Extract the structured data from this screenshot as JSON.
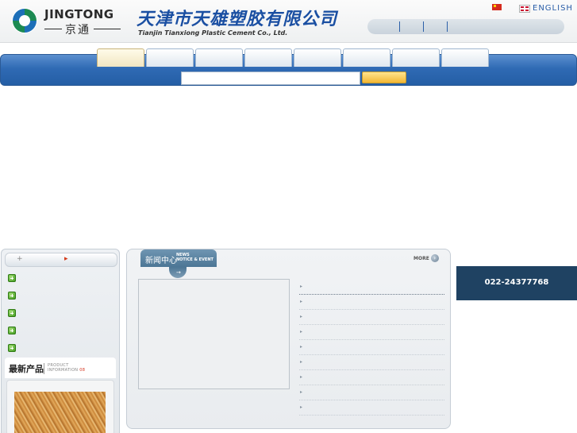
{
  "header": {
    "logo_en": "JINGTONG",
    "logo_cn": "京通",
    "company_cn": "天津市天雄塑胶有限公司",
    "company_en": "Tianjin Tianxiong Plastic Cement Co., Ltd.",
    "lang_english": "ENGLISH",
    "brand_colors": {
      "blue": "#1a4fa2",
      "nav_blue": "#2f6ab4"
    }
  },
  "nav": {
    "tabs": [
      "",
      "",
      "",
      "",
      "",
      "",
      "",
      ""
    ],
    "active_tab_index": 0,
    "search": {
      "value": "",
      "placeholder": ""
    }
  },
  "sidebar": {
    "categories": [
      "",
      "",
      "",
      "",
      ""
    ],
    "products_title": "最新产品",
    "products_en_line1": "PRODUCT",
    "products_en_line2": "INFORMATION",
    "products_en_mark": "08"
  },
  "news": {
    "title": "新闻中心",
    "sub_line1": "NEWS",
    "sub_line2": "NOTICE & EVENT",
    "more_label": "MORE",
    "items": [
      "",
      "",
      "",
      "",
      "",
      "",
      "",
      "",
      ""
    ]
  },
  "contact": {
    "phone": "022-24377768"
  }
}
